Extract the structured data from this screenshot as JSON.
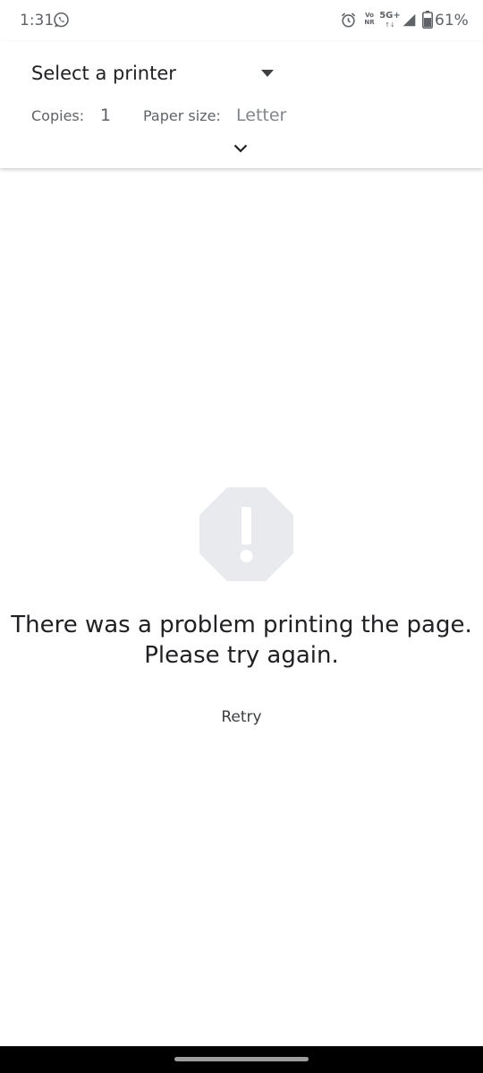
{
  "status_bar": {
    "time": "1:31",
    "battery": "61%",
    "volte_top": "Vo",
    "volte_bottom": "NR",
    "network": "5G+",
    "network_arrows": "↑↓",
    "icons": [
      "whatsapp-icon",
      "alarm-icon",
      "signal-icon",
      "battery-icon"
    ]
  },
  "header": {
    "printer_select": "Select a printer",
    "copies_label": "Copies:",
    "copies_value": "1",
    "paper_size_label": "Paper size:",
    "paper_size_value": "Letter"
  },
  "error": {
    "message_line1": "There was a problem printing the page.",
    "message_line2": "Please try again.",
    "retry_label": "Retry",
    "icon": "error-octagon-icon"
  },
  "colors": {
    "text_primary": "#202124",
    "text_secondary": "#5f6368",
    "error_icon_fill": "#e8eaed",
    "nav_bar": "#000000"
  }
}
